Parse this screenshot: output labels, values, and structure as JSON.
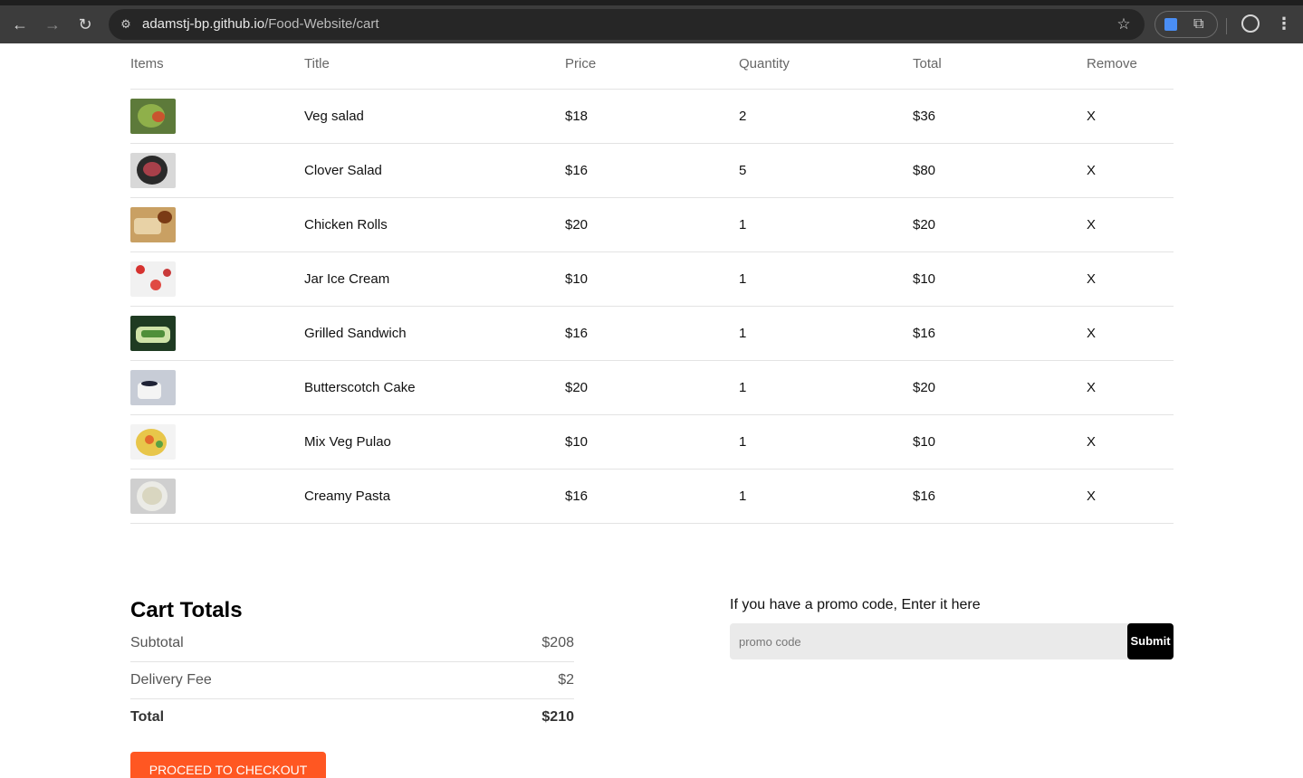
{
  "browser": {
    "url_domain": "adamstj-bp.github.io",
    "url_path": "/Food-Website/cart",
    "back_icon": "←",
    "forward_icon": "→",
    "reload_icon": "↻",
    "star_icon": "☆",
    "menu_icon": "⋮",
    "puzzle_icon": "⧉"
  },
  "cart_table": {
    "headers": {
      "items": "Items",
      "title": "Title",
      "price": "Price",
      "quantity": "Quantity",
      "total": "Total",
      "remove": "Remove"
    },
    "rows": [
      {
        "title": "Veg salad",
        "price": "$18",
        "quantity": "2",
        "total": "$36",
        "remove": "X"
      },
      {
        "title": "Clover Salad",
        "price": "$16",
        "quantity": "5",
        "total": "$80",
        "remove": "X"
      },
      {
        "title": "Chicken Rolls",
        "price": "$20",
        "quantity": "1",
        "total": "$20",
        "remove": "X"
      },
      {
        "title": "Jar Ice Cream",
        "price": "$10",
        "quantity": "1",
        "total": "$10",
        "remove": "X"
      },
      {
        "title": "Grilled Sandwich",
        "price": "$16",
        "quantity": "1",
        "total": "$16",
        "remove": "X"
      },
      {
        "title": "Butterscotch Cake",
        "price": "$20",
        "quantity": "1",
        "total": "$20",
        "remove": "X"
      },
      {
        "title": "Mix Veg Pulao",
        "price": "$10",
        "quantity": "1",
        "total": "$10",
        "remove": "X"
      },
      {
        "title": "Creamy Pasta",
        "price": "$16",
        "quantity": "1",
        "total": "$16",
        "remove": "X"
      }
    ]
  },
  "cart_totals": {
    "heading": "Cart Totals",
    "subtotal_label": "Subtotal",
    "subtotal_value": "$208",
    "delivery_label": "Delivery Fee",
    "delivery_value": "$2",
    "total_label": "Total",
    "total_value": "$210",
    "checkout_label": "PROCEED TO CHECKOUT"
  },
  "promo": {
    "prompt": "If you have a promo code, Enter it here",
    "placeholder": "promo code",
    "submit_label": "Submit"
  },
  "colors": {
    "accent": "#ff5722",
    "submit_bg": "#000000",
    "promo_bg": "#eaeaea",
    "divider": "#e3e3e3"
  }
}
